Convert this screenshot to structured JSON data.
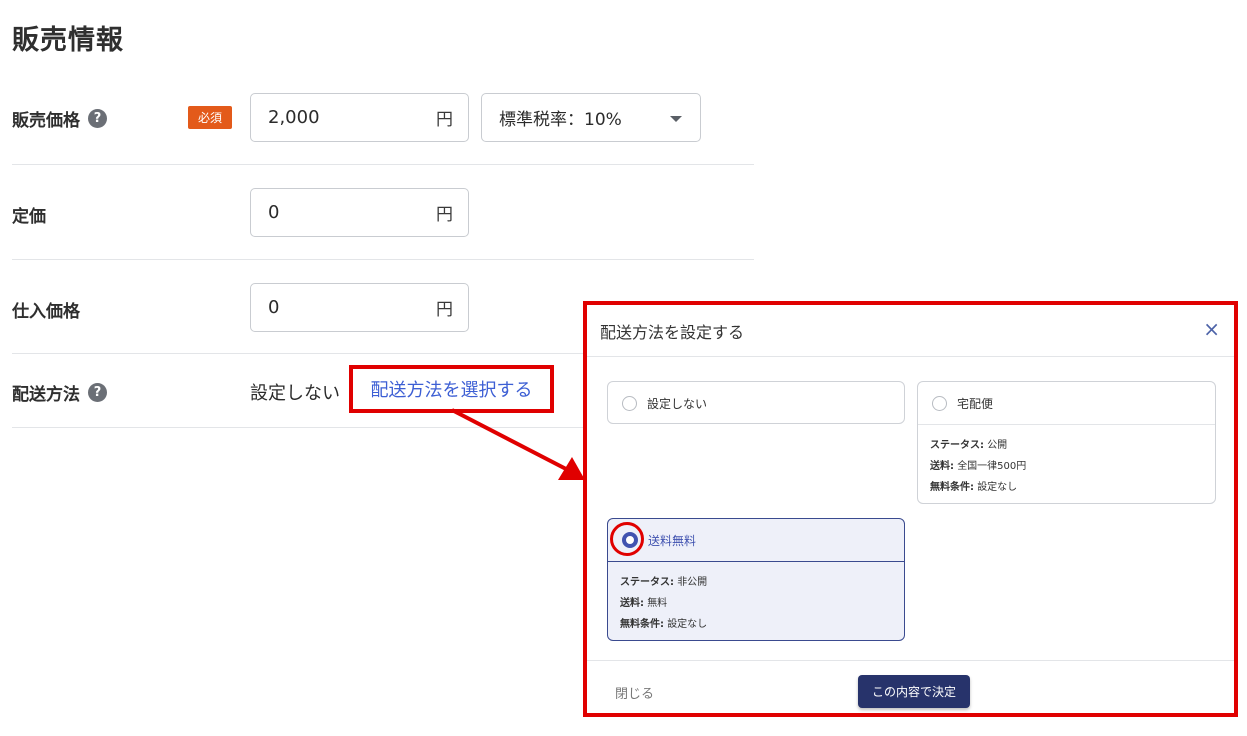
{
  "section": {
    "title": "販売情報"
  },
  "rows": {
    "sale_price": {
      "label": "販売価格",
      "required": "必須",
      "value": "2,000",
      "unit": "円",
      "tax_select": "標準税率：10%"
    },
    "list_price": {
      "label": "定価",
      "value": "0",
      "unit": "円"
    },
    "cost_price": {
      "label": "仕入価格",
      "value": "0",
      "unit": "円"
    },
    "shipping": {
      "label": "配送方法",
      "current": "設定しない",
      "select_link": "配送方法を選択する"
    }
  },
  "help_icon_glyph": "?",
  "modal": {
    "title": "配送方法を設定する",
    "close_glyph": "×",
    "options": [
      {
        "label": "設定しない"
      },
      {
        "label": "宅配便",
        "status_label": "ステータス:",
        "status": "公開",
        "fee_label": "送料:",
        "fee": "全国一律500円",
        "free_label": "無料条件:",
        "free": "設定なし"
      },
      {
        "label": "送料無料",
        "status_label": "ステータス:",
        "status": "非公開",
        "fee_label": "送料:",
        "fee": "無料",
        "free_label": "無料条件:",
        "free": "設定なし"
      }
    ],
    "selected_option": "送料無料",
    "close_label": "閉じる",
    "confirm_label": "この内容で決定"
  },
  "colors": {
    "required_badge": "#e35a1a",
    "link": "#3d5fd4",
    "confirm_button": "#27336b",
    "highlight": "#e00000"
  },
  "icons": [
    "help-icon",
    "chevron-down-icon",
    "close-icon",
    "radio-icon"
  ]
}
